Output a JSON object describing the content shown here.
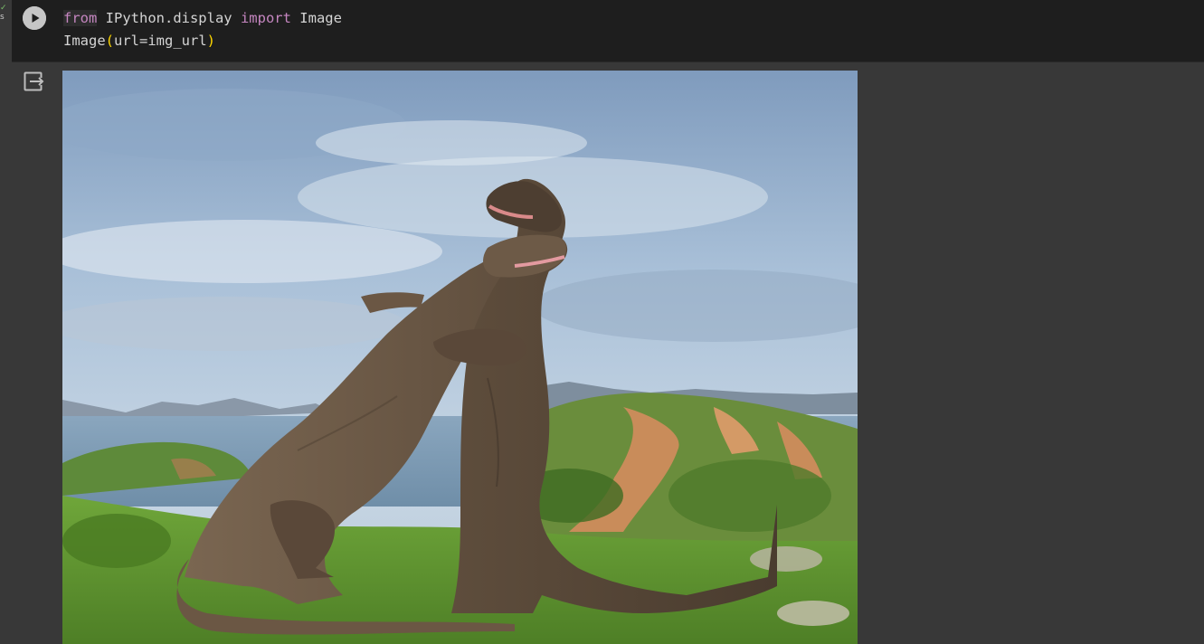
{
  "cell": {
    "exec_mark": "s",
    "run_icon": "play-icon",
    "code_lines": [
      [
        {
          "text": "from",
          "cls": "kw kw-hl"
        },
        {
          "text": " IPython.display ",
          "cls": ""
        },
        {
          "text": "import",
          "cls": "kw"
        },
        {
          "text": " Image",
          "cls": ""
        }
      ],
      [
        {
          "text": "Image",
          "cls": ""
        },
        {
          "text": "(",
          "cls": "paren"
        },
        {
          "text": "url=img_url",
          "cls": ""
        },
        {
          "text": ")",
          "cls": "paren"
        }
      ]
    ]
  },
  "output": {
    "icon": "output-toggle-icon",
    "image_subject": "two komodo dragons wrestling upright on a grassy hill with sea and islands behind"
  },
  "colors": {
    "background": "#383838",
    "code_background": "#1e1e1e",
    "keyword": "#c586c0",
    "paren": "#ffd700",
    "text": "#d4d4d4"
  }
}
